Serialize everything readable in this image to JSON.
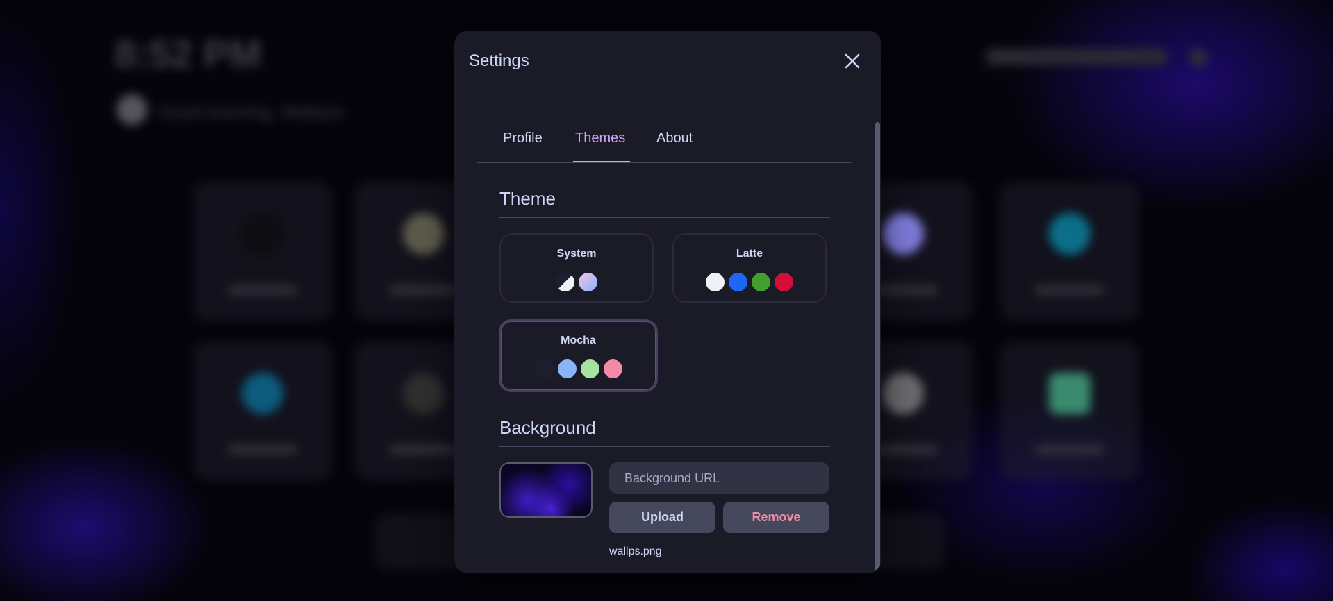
{
  "background": {
    "clock": "8:52 PM",
    "greeting": "Good evening, Wallace"
  },
  "settings": {
    "title": "Settings",
    "close_icon": "close-icon",
    "tabs": [
      {
        "label": "Profile",
        "active": false
      },
      {
        "label": "Themes",
        "active": true
      },
      {
        "label": "About",
        "active": false
      }
    ],
    "theme_section": {
      "title": "Theme",
      "themes": [
        {
          "name": "System",
          "selected": false,
          "swatches": [
            "half-light-dark",
            "gradient #f5c2e7-#89b4fa"
          ]
        },
        {
          "name": "Latte",
          "selected": false,
          "swatches": [
            "#eff1f5",
            "#1e66f5",
            "#40a02b",
            "#d20f39"
          ]
        },
        {
          "name": "Mocha",
          "selected": true,
          "swatches": [
            "#1e1e2e",
            "#89b4fa",
            "#a6e3a1",
            "#f38ba8"
          ]
        }
      ]
    },
    "background_section": {
      "title": "Background",
      "url_placeholder": "Background URL",
      "upload_label": "Upload",
      "remove_label": "Remove",
      "file_name": "wallps.png"
    }
  },
  "colors": {
    "accent": "#cba6f7",
    "remove": "#f38ba8",
    "text": "#cdd6f4",
    "surface": "#1b1a27"
  }
}
